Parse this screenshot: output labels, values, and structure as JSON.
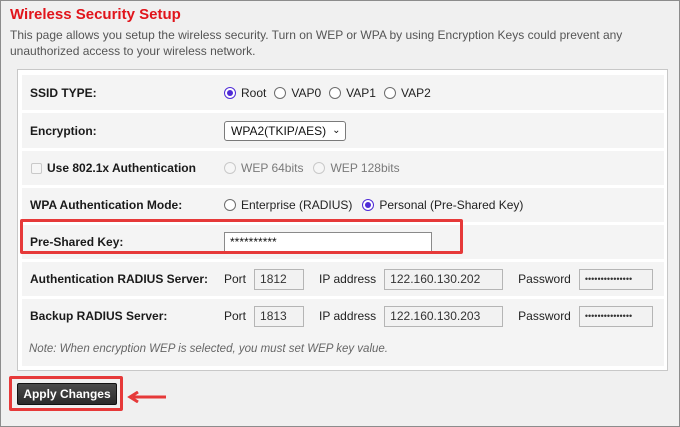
{
  "header": {
    "title": "Wireless Security Setup",
    "description": "This page allows you setup the wireless security. Turn on WEP or WPA by using Encryption Keys could prevent any unauthorized access to your wireless network."
  },
  "ssid_type": {
    "label": "SSID TYPE:",
    "options": [
      "Root",
      "VAP0",
      "VAP1",
      "VAP2"
    ],
    "selected": "Root"
  },
  "encryption": {
    "label": "Encryption:",
    "value": "WPA2(TKIP/AES)"
  },
  "auth_8021x": {
    "label": "Use 802.1x Authentication",
    "checked": false,
    "options": [
      "WEP 64bits",
      "WEP 128bits"
    ]
  },
  "wpa_mode": {
    "label": "WPA Authentication Mode:",
    "options": [
      "Enterprise (RADIUS)",
      "Personal (Pre-Shared Key)"
    ],
    "selected": "Personal (Pre-Shared Key)"
  },
  "psk": {
    "label": "Pre-Shared Key:",
    "value": "**********"
  },
  "radius": {
    "label": "Authentication RADIUS Server:",
    "port_label": "Port",
    "port": "1812",
    "ip_label": "IP address",
    "ip": "122.160.130.202",
    "password_label": "Password",
    "password": "•••••••••••••••"
  },
  "backup_radius": {
    "label": "Backup RADIUS Server:",
    "port_label": "Port",
    "port": "1813",
    "ip_label": "IP address",
    "ip": "122.160.130.203",
    "password_label": "Password",
    "password": "•••••••••••••••"
  },
  "note": "Note: When encryption WEP is selected, you must set WEP key value.",
  "apply_label": "Apply Changes",
  "colors": {
    "title": "#e1141b",
    "highlight": "#e63939",
    "radio_selected": "#4f2bd6"
  }
}
